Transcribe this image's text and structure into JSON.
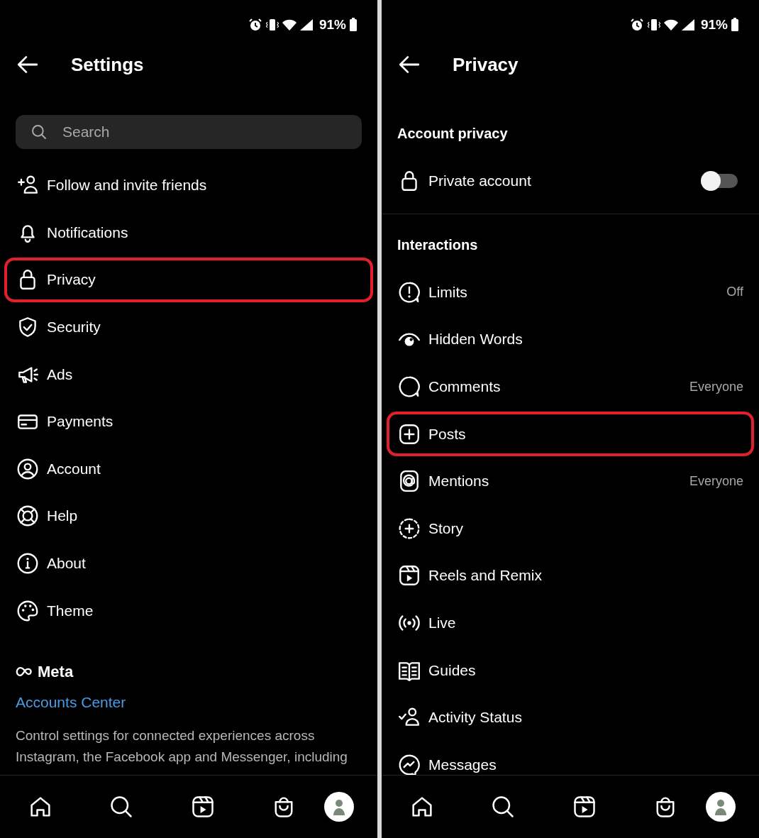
{
  "screens": [
    {
      "status_bar": {
        "battery": "91%"
      },
      "header": {
        "title": "Settings"
      },
      "search": {
        "placeholder": "Search"
      },
      "items": [
        {
          "label": "Follow and invite friends",
          "highlighted": false
        },
        {
          "label": "Notifications",
          "highlighted": false
        },
        {
          "label": "Privacy",
          "highlighted": true
        },
        {
          "label": "Security",
          "highlighted": false
        },
        {
          "label": "Ads",
          "highlighted": false
        },
        {
          "label": "Payments",
          "highlighted": false
        },
        {
          "label": "Account",
          "highlighted": false
        },
        {
          "label": "Help",
          "highlighted": false
        },
        {
          "label": "About",
          "highlighted": false
        },
        {
          "label": "Theme",
          "highlighted": false
        }
      ],
      "footer": {
        "brand": "Meta",
        "link": "Accounts Center",
        "description": "Control settings for connected experiences across Instagram, the Facebook app and Messenger, including"
      }
    },
    {
      "status_bar": {
        "battery": "91%"
      },
      "header": {
        "title": "Privacy"
      },
      "sections": [
        {
          "title": "Account privacy",
          "items": [
            {
              "label": "Private account",
              "kind": "toggle",
              "on": false,
              "highlighted": false
            }
          ]
        },
        {
          "title": "Interactions",
          "items": [
            {
              "label": "Limits",
              "kind": "link",
              "value": "Off",
              "highlighted": false
            },
            {
              "label": "Hidden Words",
              "kind": "link",
              "highlighted": false
            },
            {
              "label": "Comments",
              "kind": "link",
              "value": "Everyone",
              "highlighted": false
            },
            {
              "label": "Posts",
              "kind": "link",
              "highlighted": true
            },
            {
              "label": "Mentions",
              "kind": "link",
              "value": "Everyone",
              "highlighted": false
            },
            {
              "label": "Story",
              "kind": "link",
              "highlighted": false
            },
            {
              "label": "Reels and Remix",
              "kind": "link",
              "highlighted": false
            },
            {
              "label": "Live",
              "kind": "link",
              "highlighted": false
            },
            {
              "label": "Guides",
              "kind": "link",
              "highlighted": false
            },
            {
              "label": "Activity Status",
              "kind": "link",
              "highlighted": false
            },
            {
              "label": "Messages",
              "kind": "link",
              "highlighted": false
            }
          ]
        }
      ]
    }
  ]
}
